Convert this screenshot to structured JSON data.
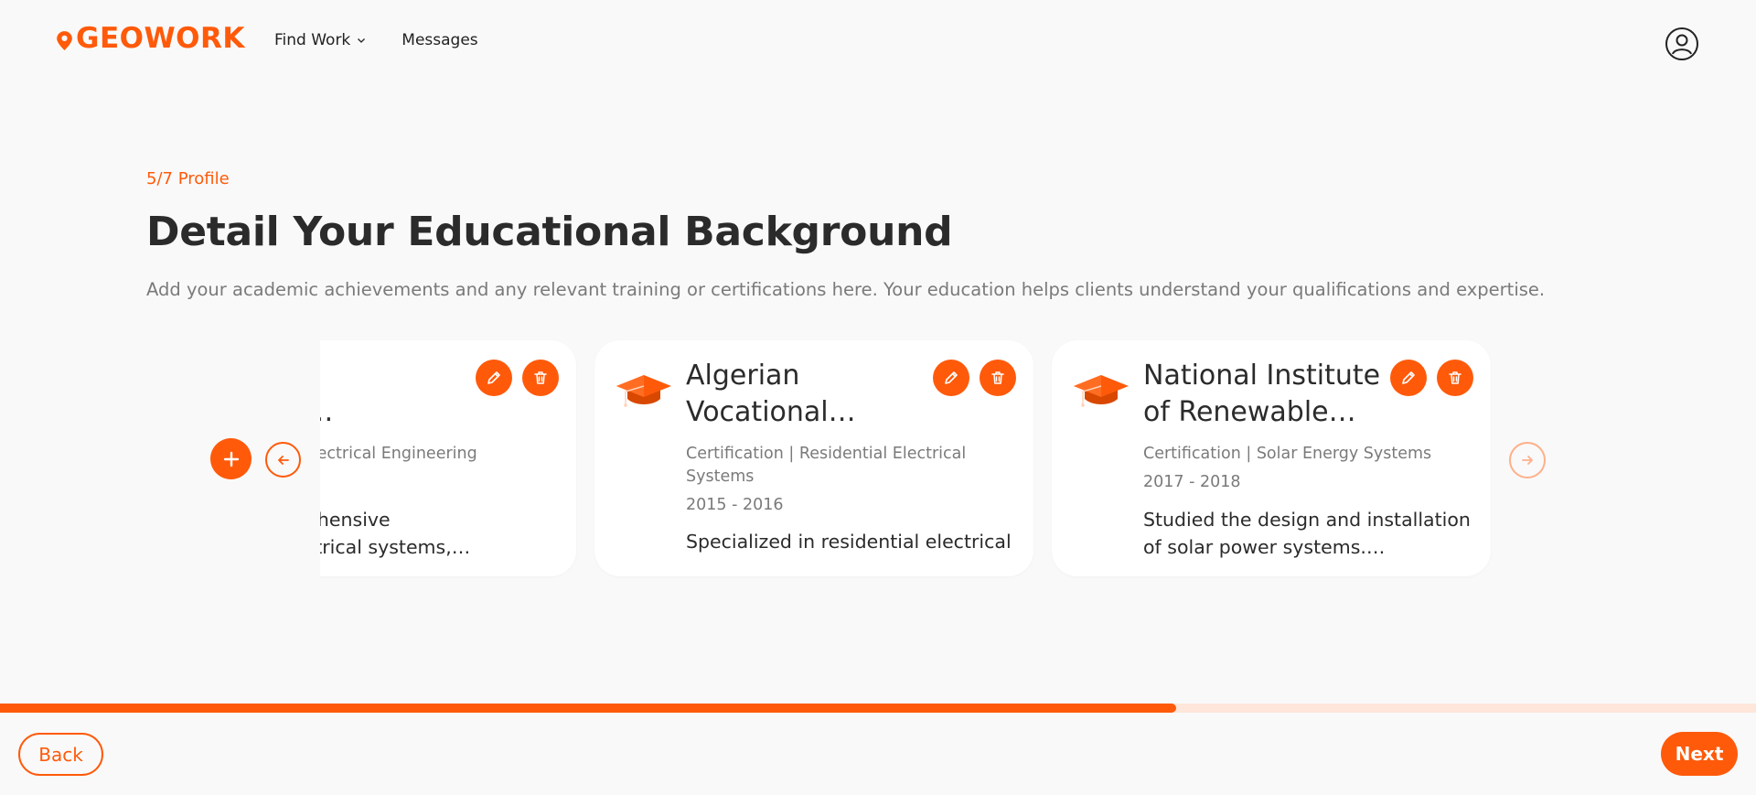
{
  "brand": {
    "logo_text": "GEOWORK",
    "accent": "#ff5a0a"
  },
  "nav": {
    "items": [
      {
        "label": "Find Work",
        "has_dropdown": true
      },
      {
        "label": "Messages",
        "has_dropdown": false
      }
    ]
  },
  "header": {
    "user_icon": "user-circle-icon"
  },
  "page": {
    "step": "5/7 Profile",
    "title": "Detail Your Educational Background",
    "subtitle": "Add your academic achievements and any relevant training or certifications here. Your education helps clients understand your qualifications and expertise."
  },
  "education": [
    {
      "institution_visible": "sity of\ne and…",
      "meta_visible": "Degree | Electrical Engineering",
      "years": "",
      "description_visible": "d comprehensive\nrk in electrical systems,…"
    },
    {
      "institution": "Algerian\nVocational…",
      "meta": "Certification | Residential Electrical Systems",
      "years": "2015 - 2016",
      "description": "Specialized in residential electrical"
    },
    {
      "institution": "National Institute\nof Renewable…",
      "meta": "Certification | Solar Energy Systems",
      "years": "2017 - 2018",
      "description": "Studied the design and installation\nof solar power systems.…"
    }
  ],
  "controls": {
    "add_icon": "plus-icon",
    "prev_icon": "arrow-left-icon",
    "next_icon": "arrow-right-icon",
    "edit_icon": "pencil-icon",
    "delete_icon": "trash-icon",
    "card_icon": "graduation-cap-icon"
  },
  "progress": {
    "fraction": 0.67
  },
  "footer": {
    "back_label": "Back",
    "next_label": "Next"
  }
}
